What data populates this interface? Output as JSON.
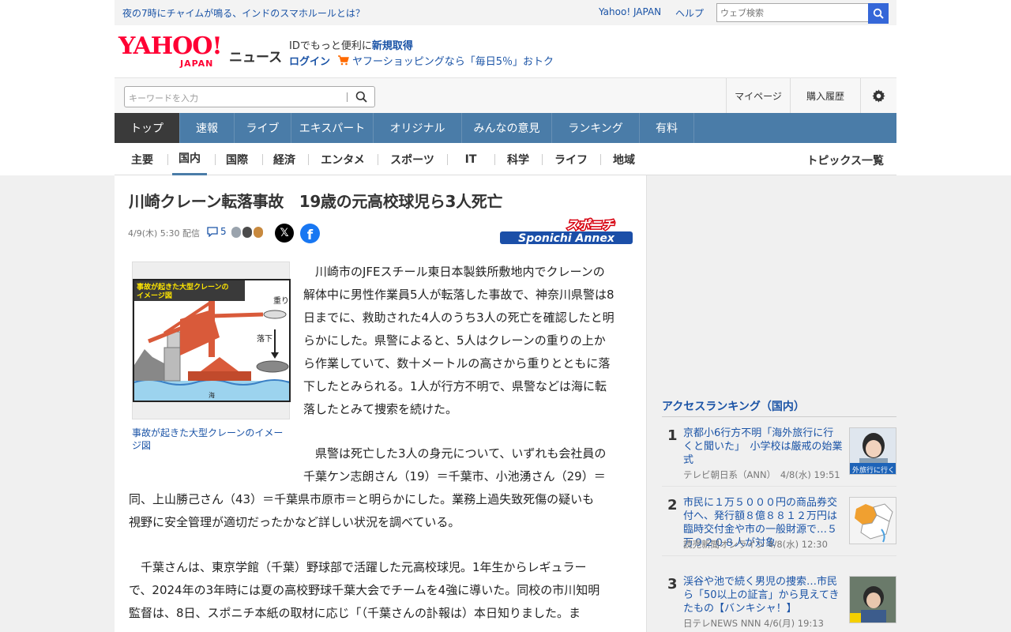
{
  "util": {
    "promo": "夜の7時にチャイムが鳴る、インドのスマホルールとは？",
    "yahoo_japan": "Yahoo! JAPAN",
    "help": "ヘルプ",
    "search_placeholder": "ウェブ検索"
  },
  "logo": {
    "yahoo": "YAHOO!",
    "japan": "JAPAN",
    "news": "ニュース"
  },
  "account": {
    "id_prefix": "IDでもっと便利に",
    "id_link": "新規取得",
    "login": "ログイン",
    "shopping": "ヤフーショッピングなら「毎日5％」おトク"
  },
  "searchbar": {
    "placeholder": "キーワードを入力",
    "mypage": "マイページ",
    "history": "購入履歴"
  },
  "main_nav": [
    "トップ",
    "速報",
    "ライブ",
    "エキスパート",
    "オリジナル",
    "みんなの意見",
    "ランキング",
    "有料"
  ],
  "sub_nav": [
    "主要",
    "国内",
    "国際",
    "経済",
    "エンタメ",
    "スポーツ",
    "IT",
    "科学",
    "ライフ",
    "地域"
  ],
  "topics_all": "トピックス一覧",
  "article": {
    "title": "川崎クレーン転落事故　19歳の元高校球児ら3人死亡",
    "date": "4/9(木) 5:30 配信",
    "comment_count": "5",
    "publisher_top": "スポニチ",
    "publisher_bottom": "Sponichi Annex",
    "figure": {
      "heading1": "事故が起きた大型クレーンの",
      "heading2": "イメージ図",
      "weight_label": "重り",
      "fall_label": "落下",
      "sea_label": "海"
    },
    "caption": "事故が起きた大型クレーンのイメージ図",
    "p1": [
      "川崎市のJFEスチール東日本製鉄所敷地内でクレーンの",
      "解体中に男性作業員5人が転落した事故で、神奈川県警は8",
      "日までに、救助された4人のうち3人の死亡を確認したと明",
      "らかにした。県警によると、5人はクレーンの重りの上か",
      "ら作業していて、数十メートルの高さから重りとともに落",
      "下したとみられる。1人が行方不明で、県警などは海に転",
      "落したとみて捜索を続けた。"
    ],
    "p2": [
      "県警は死亡した3人の身元について、いずれも会社員の",
      "千葉ケン志朗さん（19）＝千葉市、小池湧さん（29）＝",
      "同、上山勝己さん（43）＝千葉県市原市＝と明らかにした。業務上過失致死傷の疑いも",
      "視野に安全管理が適切だったかなど詳しい状況を調べている。"
    ],
    "p3": [
      "千葉さんは、東京学館（千葉）野球部で活躍した元高校球児。1年生からレギュラー",
      "で、2024年の3年時には夏の高校野球千葉大会でチームを4強に導いた。同校の市川知明",
      "監督は、8日、スポニチ本紙の取材に応じ「（千葉さんの訃報は）本日知りました。ま"
    ]
  },
  "ranking": {
    "title": "アクセスランキング（国内）",
    "items": [
      {
        "rank": "1",
        "title": "京都小6行方不明「海外旅行に行くと聞いた」　小学校は厳戒の始業式",
        "source": "テレビ朝日系（ANN）　4/8(水) 19:51",
        "thumb_text": "外旅行に行く"
      },
      {
        "rank": "2",
        "title": "市民に１万５０００円の商品券交付へ、発行額８億８８１２万円は臨時交付金や市の一般財源で…５万９２０８人が対象",
        "source": "読売新聞オンライン 4/8(水) 12:30",
        "thumb_text": ""
      },
      {
        "rank": "3",
        "title": "渓谷や池で続く男児の捜索…市民ら「50以上の証言」から見えてきたもの【バンキシャ！】",
        "source": "日テレNEWS NNN 4/6(月) 19:13",
        "thumb_text": ""
      }
    ]
  }
}
